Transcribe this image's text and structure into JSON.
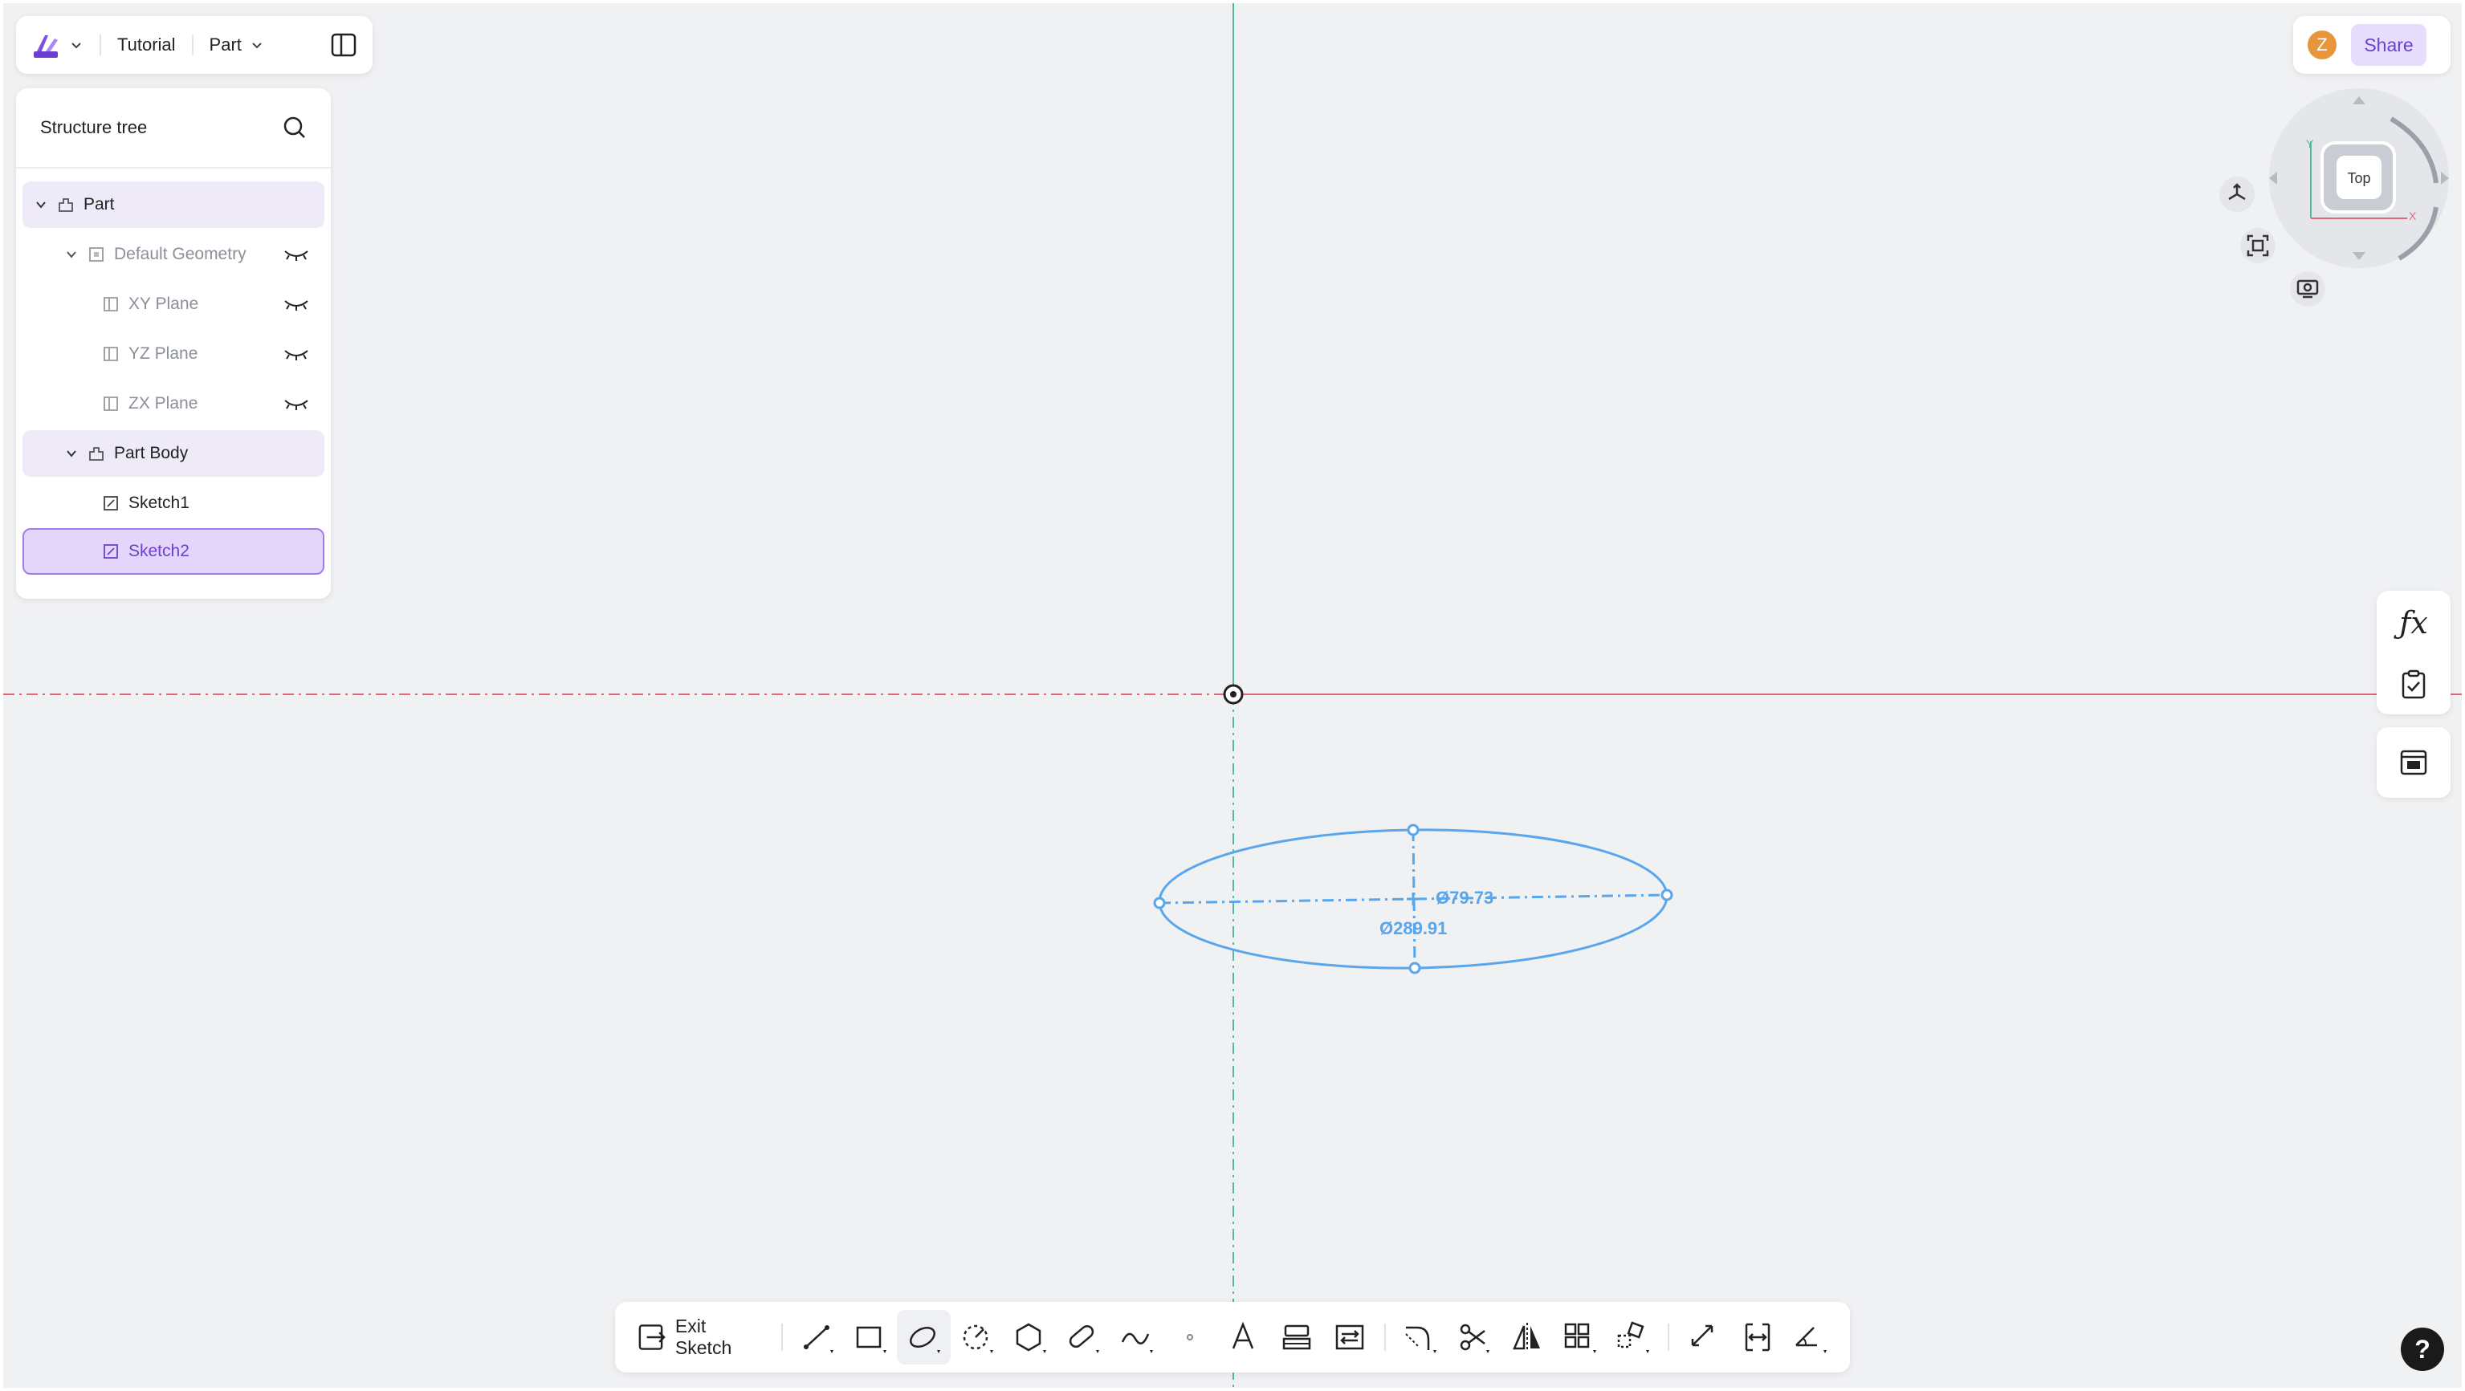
{
  "header": {
    "project_name": "Tutorial",
    "mode_label": "Part"
  },
  "tree": {
    "title": "Structure tree",
    "items": [
      {
        "label": "Part"
      },
      {
        "label": "Default Geometry"
      },
      {
        "label": "XY Plane"
      },
      {
        "label": "YZ Plane"
      },
      {
        "label": "ZX Plane"
      },
      {
        "label": "Part Body"
      },
      {
        "label": "Sketch1"
      },
      {
        "label": "Sketch2"
      }
    ]
  },
  "user": {
    "avatar_initial": "Z",
    "share_label": "Share"
  },
  "viewcube": {
    "face_label": "Top",
    "axis_y": "Y",
    "axis_x": "X"
  },
  "sketch": {
    "dimensions": {
      "minor": "Ø79.73",
      "major": "Ø289.91"
    }
  },
  "toolbar": {
    "exit_label": "Exit Sketch"
  },
  "help": {
    "label": "?"
  },
  "colors": {
    "accent": "#6b3fd1",
    "x_axis": "#e0667a",
    "y_axis": "#55b89a",
    "sketch": "#5aa6ec"
  }
}
